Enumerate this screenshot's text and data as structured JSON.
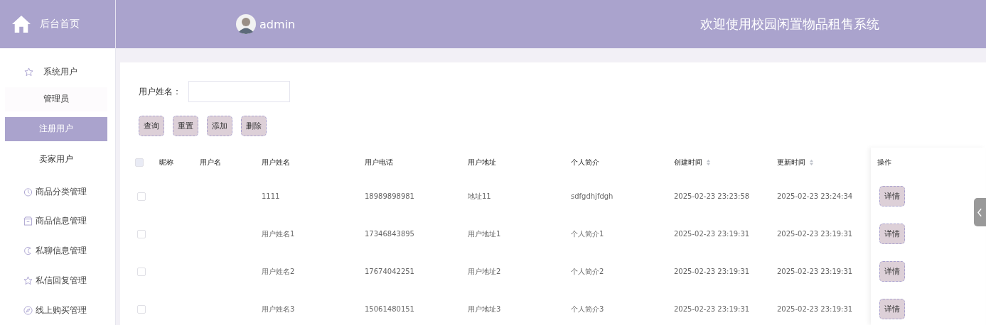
{
  "header": {
    "home_label": "后台首页",
    "username": "admin",
    "title": "欢迎使用校园闲置物品租售系统"
  },
  "sidebar": {
    "items": [
      {
        "label": "系统用户",
        "kind": "star",
        "expanded": true,
        "children": [
          {
            "label": "管理员",
            "selected": false
          },
          {
            "label": "注册用户",
            "selected": true
          },
          {
            "label": "卖家用户",
            "selected": false
          }
        ]
      },
      {
        "label": "商品分类管理",
        "kind": "dial",
        "expanded": false
      },
      {
        "label": "商品信息管理",
        "kind": "box",
        "expanded": false
      },
      {
        "label": "私聊信息管理",
        "kind": "moon",
        "expanded": false
      },
      {
        "label": "私信回复管理",
        "kind": "star",
        "expanded": false
      },
      {
        "label": "线上购买管理",
        "kind": "compass",
        "expanded": false
      }
    ]
  },
  "search": {
    "label": "用户姓名："
  },
  "buttons": [
    "查询",
    "重置",
    "添加",
    "删除"
  ],
  "table": {
    "all_checked": false,
    "columns": [
      {
        "label": "昵称",
        "sortable": false
      },
      {
        "label": "用户名",
        "sortable": false
      },
      {
        "label": "用户姓名",
        "sortable": false
      },
      {
        "label": "用户电话",
        "sortable": false
      },
      {
        "label": "用户地址",
        "sortable": false
      },
      {
        "label": "个人简介",
        "sortable": false
      },
      {
        "label": "创建时间",
        "sortable": true
      },
      {
        "label": "更新时间",
        "sortable": true
      }
    ],
    "action_column": "操作",
    "rows": [
      {
        "cells": [
          "",
          "",
          "1111",
          "18989898981",
          "地址11",
          "sdfgdhjfdgh",
          "2025-02-23 23:23:58",
          "2025-02-23 23:24:34"
        ],
        "checked": false,
        "action": "详情"
      },
      {
        "cells": [
          "",
          "",
          "用户姓名1",
          "17346843895",
          "用户地址1",
          "个人简介1",
          "2025-02-23 23:19:31",
          "2025-02-23 23:19:31"
        ],
        "checked": false,
        "action": "详情"
      },
      {
        "cells": [
          "",
          "",
          "用户姓名2",
          "17674042251",
          "用户地址2",
          "个人简介2",
          "2025-02-23 23:19:31",
          "2025-02-23 23:19:31"
        ],
        "checked": false,
        "action": "详情"
      },
      {
        "cells": [
          "",
          "",
          "用户姓名3",
          "15061480151",
          "用户地址3",
          "个人简介3",
          "2025-02-23 23:19:31",
          "2025-02-23 23:19:31"
        ],
        "checked": false,
        "action": "详情"
      }
    ]
  }
}
